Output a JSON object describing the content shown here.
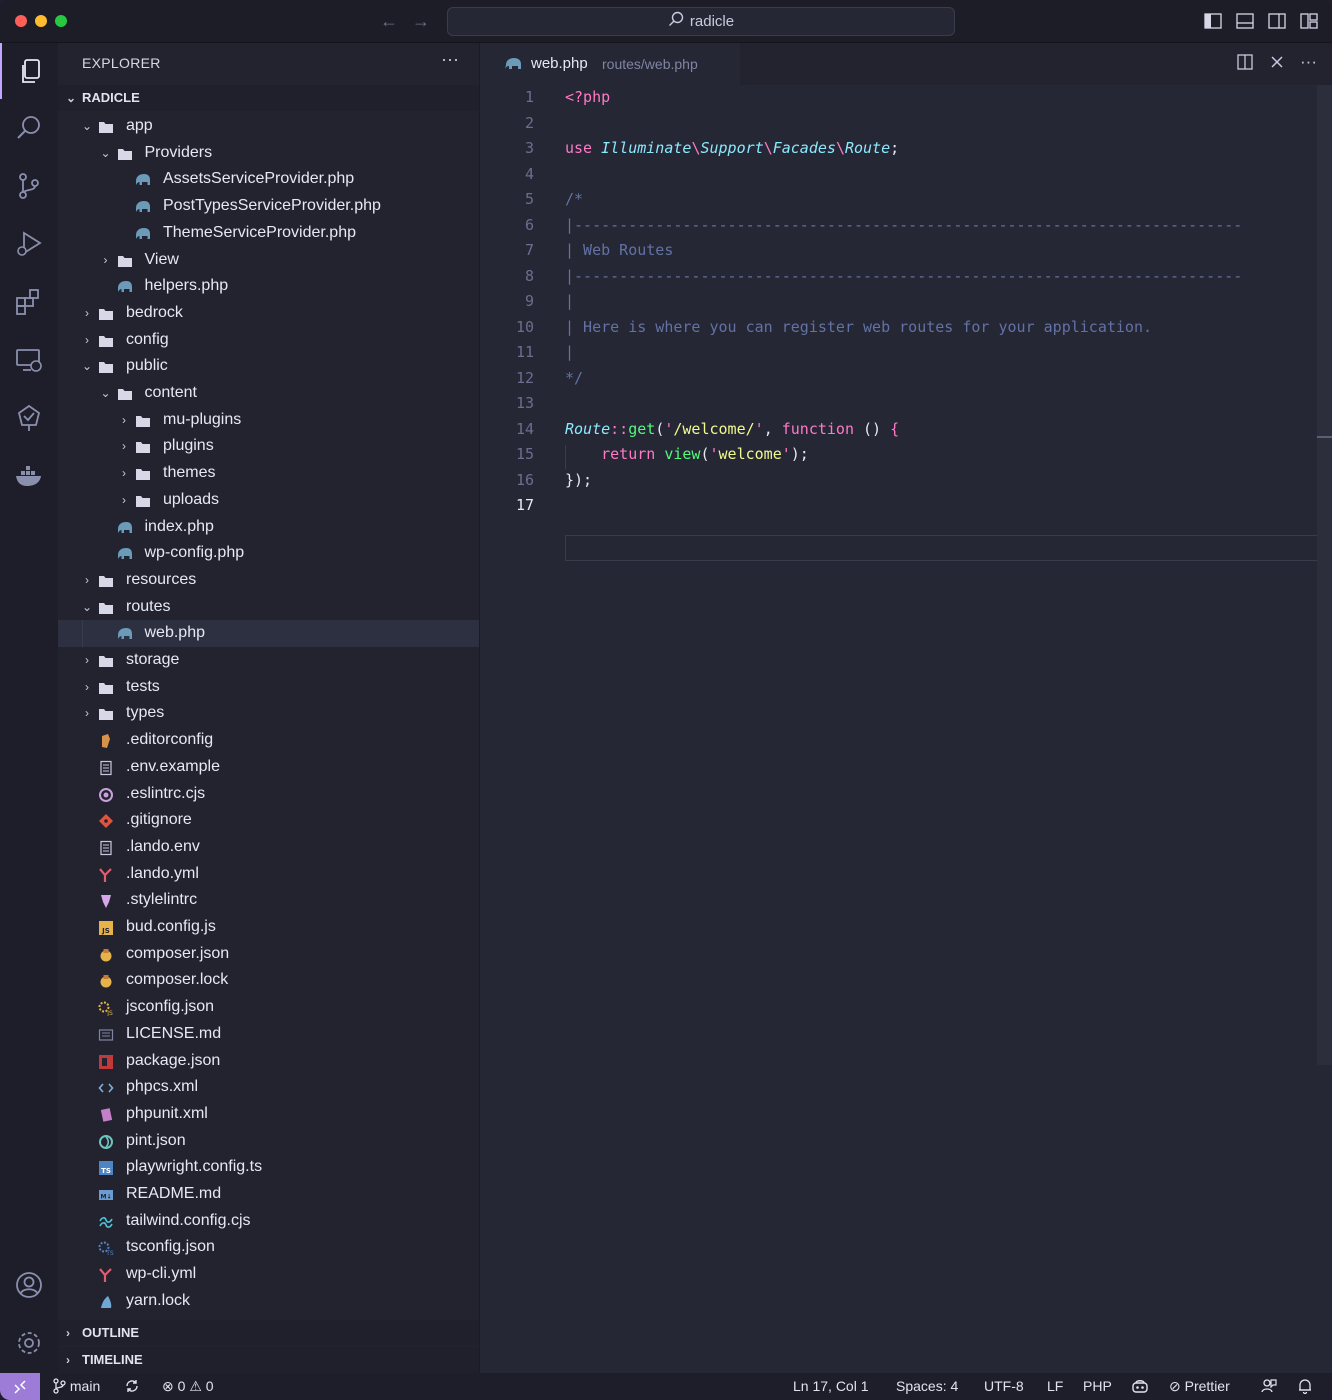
{
  "titlebar": {
    "search": "radicle"
  },
  "sidebar": {
    "title": "EXPLORER",
    "more": "···",
    "root": "RADICLE",
    "tree": [
      {
        "label": "app",
        "type": "folder",
        "depth": 1,
        "open": true
      },
      {
        "label": "Providers",
        "type": "folder",
        "depth": 2,
        "open": true
      },
      {
        "label": "AssetsServiceProvider.php",
        "type": "php",
        "depth": 3
      },
      {
        "label": "PostTypesServiceProvider.php",
        "type": "php",
        "depth": 3
      },
      {
        "label": "ThemeServiceProvider.php",
        "type": "php",
        "depth": 3
      },
      {
        "label": "View",
        "type": "folder",
        "depth": 2,
        "open": false
      },
      {
        "label": "helpers.php",
        "type": "php",
        "depth": 2
      },
      {
        "label": "bedrock",
        "type": "folder",
        "depth": 1,
        "open": false
      },
      {
        "label": "config",
        "type": "folder",
        "depth": 1,
        "open": false
      },
      {
        "label": "public",
        "type": "folder",
        "depth": 1,
        "open": true
      },
      {
        "label": "content",
        "type": "folder",
        "depth": 2,
        "open": true
      },
      {
        "label": "mu-plugins",
        "type": "folder",
        "depth": 3,
        "open": false
      },
      {
        "label": "plugins",
        "type": "folder",
        "depth": 3,
        "open": false
      },
      {
        "label": "themes",
        "type": "folder",
        "depth": 3,
        "open": false
      },
      {
        "label": "uploads",
        "type": "folder",
        "depth": 3,
        "open": false
      },
      {
        "label": "index.php",
        "type": "php",
        "depth": 2
      },
      {
        "label": "wp-config.php",
        "type": "php",
        "depth": 2
      },
      {
        "label": "resources",
        "type": "folder",
        "depth": 1,
        "open": false
      },
      {
        "label": "routes",
        "type": "folder",
        "depth": 1,
        "open": true
      },
      {
        "label": "web.php",
        "type": "php",
        "depth": 2,
        "selected": true
      },
      {
        "label": "storage",
        "type": "folder",
        "depth": 1,
        "open": false
      },
      {
        "label": "tests",
        "type": "folder",
        "depth": 1,
        "open": false
      },
      {
        "label": "types",
        "type": "folder",
        "depth": 1,
        "open": false
      },
      {
        "label": ".editorconfig",
        "type": "editorconfig",
        "depth": 1
      },
      {
        "label": ".env.example",
        "type": "text",
        "depth": 1
      },
      {
        "label": ".eslintrc.cjs",
        "type": "eslint",
        "depth": 1
      },
      {
        "label": ".gitignore",
        "type": "git",
        "depth": 1
      },
      {
        "label": ".lando.env",
        "type": "text",
        "depth": 1
      },
      {
        "label": ".lando.yml",
        "type": "yaml",
        "depth": 1
      },
      {
        "label": ".stylelintrc",
        "type": "stylelint",
        "depth": 1
      },
      {
        "label": "bud.config.js",
        "type": "js",
        "depth": 1
      },
      {
        "label": "composer.json",
        "type": "composer",
        "depth": 1
      },
      {
        "label": "composer.lock",
        "type": "composer",
        "depth": 1
      },
      {
        "label": "jsconfig.json",
        "type": "jsconfig",
        "depth": 1
      },
      {
        "label": "LICENSE.md",
        "type": "license",
        "depth": 1
      },
      {
        "label": "package.json",
        "type": "npm",
        "depth": 1
      },
      {
        "label": "phpcs.xml",
        "type": "xml",
        "depth": 1
      },
      {
        "label": "phpunit.xml",
        "type": "phpunit",
        "depth": 1
      },
      {
        "label": "pint.json",
        "type": "pint",
        "depth": 1
      },
      {
        "label": "playwright.config.ts",
        "type": "ts",
        "depth": 1
      },
      {
        "label": "README.md",
        "type": "markdown",
        "depth": 1
      },
      {
        "label": "tailwind.config.cjs",
        "type": "tailwind",
        "depth": 1
      },
      {
        "label": "tsconfig.json",
        "type": "tsconfig",
        "depth": 1
      },
      {
        "label": "wp-cli.yml",
        "type": "yaml",
        "depth": 1
      },
      {
        "label": "yarn.lock",
        "type": "yarn",
        "depth": 1
      }
    ],
    "outline": "OUTLINE",
    "timeline": "TIMELINE"
  },
  "editor": {
    "tab": {
      "name": "web.php",
      "path": "routes/web.php"
    },
    "line_numbers": [
      "1",
      "2",
      "3",
      "4",
      "5",
      "6",
      "7",
      "8",
      "9",
      "10",
      "11",
      "12",
      "13",
      "14",
      "15",
      "16",
      "17"
    ],
    "current_line": 17,
    "code": {
      "l1": "<?php",
      "l3_use": "use",
      "l3_ns1": "Illuminate",
      "l3_ns2": "Support",
      "l3_ns3": "Facades",
      "l3_ns4": "Route",
      "l5": "/*",
      "l6": "|--------------------------------------------------------------------------",
      "l7": "| Web Routes",
      "l8": "|--------------------------------------------------------------------------",
      "l9": "|",
      "l10": "| Here is where you can register web routes for your application.",
      "l11": "|",
      "l12": "*/",
      "l14_cls": "Route",
      "l14_op": "::",
      "l14_fn": "get",
      "l14_str": "/welcome/",
      "l14_kw": "function",
      "l15_kw": "return",
      "l15_fn": "view",
      "l15_str": "welcome",
      "l16": "});"
    }
  },
  "statusbar": {
    "branch": "main",
    "errors": "0",
    "warnings": "0",
    "position": "Ln 17, Col 1",
    "spaces": "Spaces: 4",
    "encoding": "UTF-8",
    "eol": "LF",
    "language": "PHP",
    "prettier": "Prettier"
  },
  "colors": {
    "accent": "#c3a6ff",
    "remote": "#9d7cd8",
    "php_icon": "#6b9bb8",
    "folder": "#d6d8e8"
  }
}
